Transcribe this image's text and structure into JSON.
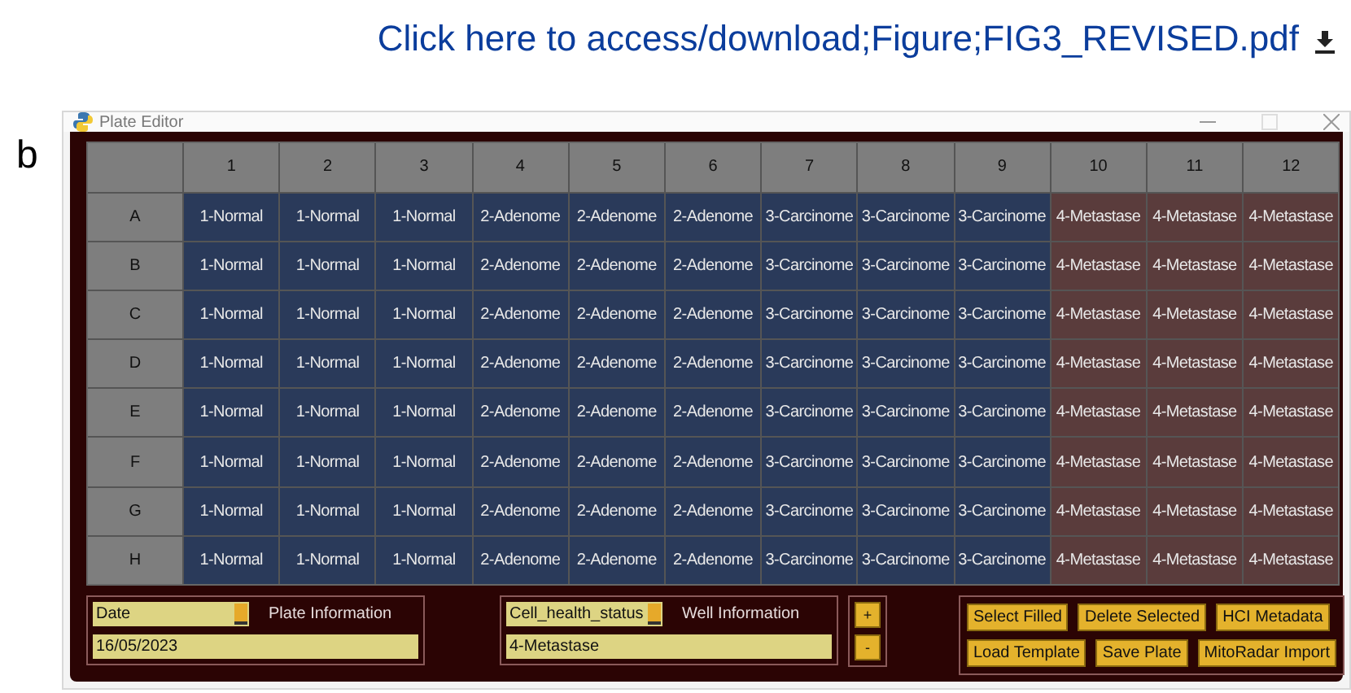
{
  "link": {
    "text": "Click here to access/download;Figure;FIG3_REVISED.pdf"
  },
  "panel_label": "b",
  "window": {
    "title": "Plate Editor"
  },
  "plate": {
    "columns": [
      "1",
      "2",
      "3",
      "4",
      "5",
      "6",
      "7",
      "8",
      "9",
      "10",
      "11",
      "12"
    ],
    "rows": [
      {
        "label": "A",
        "cells": [
          {
            "text": "1-Normal",
            "color": "#2a3a5a"
          },
          {
            "text": "1-Normal",
            "color": "#2a3a5a"
          },
          {
            "text": "1-Normal",
            "color": "#2a3a5a"
          },
          {
            "text": "2-Adenome",
            "color": "#2a3a5a"
          },
          {
            "text": "2-Adenome",
            "color": "#2a3a5a"
          },
          {
            "text": "2-Adenome",
            "color": "#2a3a5a"
          },
          {
            "text": "3-Carcinome",
            "color": "#2a3a5a"
          },
          {
            "text": "3-Carcinome",
            "color": "#2a3a5a"
          },
          {
            "text": "3-Carcinome",
            "color": "#2a3a5a"
          },
          {
            "text": "4-Metastase",
            "color": "#5a3c3c"
          },
          {
            "text": "4-Metastase",
            "color": "#5a3c3c"
          },
          {
            "text": "4-Metastase",
            "color": "#5a3c3c"
          }
        ]
      },
      {
        "label": "B",
        "cells": [
          {
            "text": "1-Normal",
            "color": "#2a3a5a"
          },
          {
            "text": "1-Normal",
            "color": "#2a3a5a"
          },
          {
            "text": "1-Normal",
            "color": "#2a3a5a"
          },
          {
            "text": "2-Adenome",
            "color": "#2a3a5a"
          },
          {
            "text": "2-Adenome",
            "color": "#2a3a5a"
          },
          {
            "text": "2-Adenome",
            "color": "#2a3a5a"
          },
          {
            "text": "3-Carcinome",
            "color": "#2a3a5a"
          },
          {
            "text": "3-Carcinome",
            "color": "#2a3a5a"
          },
          {
            "text": "3-Carcinome",
            "color": "#2a3a5a"
          },
          {
            "text": "4-Metastase",
            "color": "#5a3c3c"
          },
          {
            "text": "4-Metastase",
            "color": "#5a3c3c"
          },
          {
            "text": "4-Metastase",
            "color": "#5a3c3c"
          }
        ]
      },
      {
        "label": "C",
        "cells": [
          {
            "text": "1-Normal",
            "color": "#2a3a5a"
          },
          {
            "text": "1-Normal",
            "color": "#2a3a5a"
          },
          {
            "text": "1-Normal",
            "color": "#2a3a5a"
          },
          {
            "text": "2-Adenome",
            "color": "#2a3a5a"
          },
          {
            "text": "2-Adenome",
            "color": "#2a3a5a"
          },
          {
            "text": "2-Adenome",
            "color": "#2a3a5a"
          },
          {
            "text": "3-Carcinome",
            "color": "#2a3a5a"
          },
          {
            "text": "3-Carcinome",
            "color": "#2a3a5a"
          },
          {
            "text": "3-Carcinome",
            "color": "#2a3a5a"
          },
          {
            "text": "4-Metastase",
            "color": "#5a3c3c"
          },
          {
            "text": "4-Metastase",
            "color": "#5a3c3c"
          },
          {
            "text": "4-Metastase",
            "color": "#5a3c3c"
          }
        ]
      },
      {
        "label": "D",
        "cells": [
          {
            "text": "1-Normal",
            "color": "#2a3a5a"
          },
          {
            "text": "1-Normal",
            "color": "#2a3a5a"
          },
          {
            "text": "1-Normal",
            "color": "#2a3a5a"
          },
          {
            "text": "2-Adenome",
            "color": "#2a3a5a"
          },
          {
            "text": "2-Adenome",
            "color": "#2a3a5a"
          },
          {
            "text": "2-Adenome",
            "color": "#2a3a5a"
          },
          {
            "text": "3-Carcinome",
            "color": "#2a3a5a"
          },
          {
            "text": "3-Carcinome",
            "color": "#2a3a5a"
          },
          {
            "text": "3-Carcinome",
            "color": "#2a3a5a"
          },
          {
            "text": "4-Metastase",
            "color": "#5a3c3c"
          },
          {
            "text": "4-Metastase",
            "color": "#5a3c3c"
          },
          {
            "text": "4-Metastase",
            "color": "#5a3c3c"
          }
        ]
      },
      {
        "label": "E",
        "cells": [
          {
            "text": "1-Normal",
            "color": "#2a3a5a"
          },
          {
            "text": "1-Normal",
            "color": "#2a3a5a"
          },
          {
            "text": "1-Normal",
            "color": "#2a3a5a"
          },
          {
            "text": "2-Adenome",
            "color": "#2a3a5a"
          },
          {
            "text": "2-Adenome",
            "color": "#2a3a5a"
          },
          {
            "text": "2-Adenome",
            "color": "#2a3a5a"
          },
          {
            "text": "3-Carcinome",
            "color": "#2a3a5a"
          },
          {
            "text": "3-Carcinome",
            "color": "#2a3a5a"
          },
          {
            "text": "3-Carcinome",
            "color": "#2a3a5a"
          },
          {
            "text": "4-Metastase",
            "color": "#5a3c3c"
          },
          {
            "text": "4-Metastase",
            "color": "#5a3c3c"
          },
          {
            "text": "4-Metastase",
            "color": "#5a3c3c"
          }
        ]
      },
      {
        "label": "F",
        "cells": [
          {
            "text": "1-Normal",
            "color": "#2a3a5a"
          },
          {
            "text": "1-Normal",
            "color": "#2a3a5a"
          },
          {
            "text": "1-Normal",
            "color": "#2a3a5a"
          },
          {
            "text": "2-Adenome",
            "color": "#2a3a5a"
          },
          {
            "text": "2-Adenome",
            "color": "#2a3a5a"
          },
          {
            "text": "2-Adenome",
            "color": "#2a3a5a"
          },
          {
            "text": "3-Carcinome",
            "color": "#2a3a5a"
          },
          {
            "text": "3-Carcinome",
            "color": "#2a3a5a"
          },
          {
            "text": "3-Carcinome",
            "color": "#2a3a5a"
          },
          {
            "text": "4-Metastase",
            "color": "#5a3c3c"
          },
          {
            "text": "4-Metastase",
            "color": "#5a3c3c"
          },
          {
            "text": "4-Metastase",
            "color": "#5a3c3c"
          }
        ]
      },
      {
        "label": "G",
        "cells": [
          {
            "text": "1-Normal",
            "color": "#2a3a5a"
          },
          {
            "text": "1-Normal",
            "color": "#2a3a5a"
          },
          {
            "text": "1-Normal",
            "color": "#2a3a5a"
          },
          {
            "text": "2-Adenome",
            "color": "#2a3a5a"
          },
          {
            "text": "2-Adenome",
            "color": "#2a3a5a"
          },
          {
            "text": "2-Adenome",
            "color": "#2a3a5a"
          },
          {
            "text": "3-Carcinome",
            "color": "#2a3a5a"
          },
          {
            "text": "3-Carcinome",
            "color": "#2a3a5a"
          },
          {
            "text": "3-Carcinome",
            "color": "#2a3a5a"
          },
          {
            "text": "4-Metastase",
            "color": "#5a3c3c"
          },
          {
            "text": "4-Metastase",
            "color": "#5a3c3c"
          },
          {
            "text": "4-Metastase",
            "color": "#5a3c3c"
          }
        ]
      },
      {
        "label": "H",
        "cells": [
          {
            "text": "1-Normal",
            "color": "#2a3a5a"
          },
          {
            "text": "1-Normal",
            "color": "#2a3a5a"
          },
          {
            "text": "1-Normal",
            "color": "#2a3a5a"
          },
          {
            "text": "2-Adenome",
            "color": "#2a3a5a"
          },
          {
            "text": "2-Adenome",
            "color": "#2a3a5a"
          },
          {
            "text": "2-Adenome",
            "color": "#2a3a5a"
          },
          {
            "text": "3-Carcinome",
            "color": "#2a3a5a"
          },
          {
            "text": "3-Carcinome",
            "color": "#2a3a5a"
          },
          {
            "text": "3-Carcinome",
            "color": "#2a3a5a"
          },
          {
            "text": "4-Metastase",
            "color": "#5a3c3c"
          },
          {
            "text": "4-Metastase",
            "color": "#5a3c3c"
          },
          {
            "text": "4-Metastase",
            "color": "#5a3c3c"
          }
        ]
      }
    ]
  },
  "plate_info": {
    "dropdown": "Date",
    "label": "Plate Information",
    "value": "16/05/2023"
  },
  "well_info": {
    "dropdown": "Cell_health_status",
    "label": "Well Information",
    "value": "4-Metastase"
  },
  "step_buttons": [
    "+",
    "-"
  ],
  "action_buttons": [
    [
      "Select Filled",
      "Delete Selected",
      "HCI Metadata"
    ],
    [
      "Load Template",
      "Save Plate",
      "MitoRadar Import"
    ]
  ]
}
